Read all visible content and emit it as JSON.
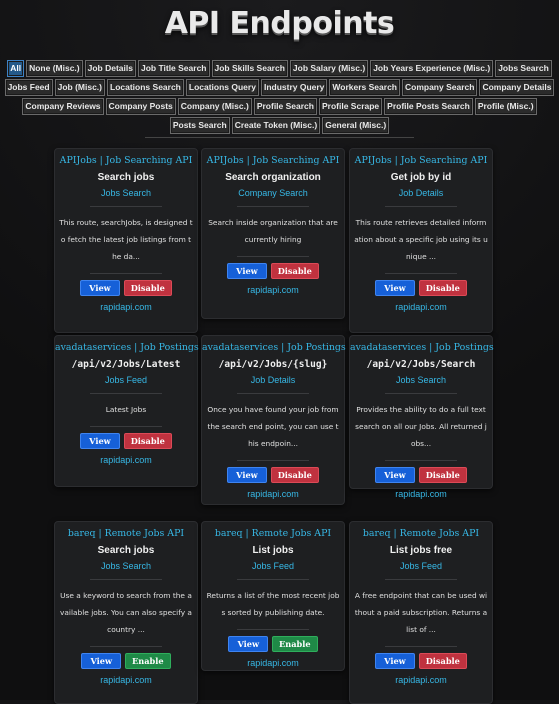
{
  "page": {
    "title": "API Endpoints"
  },
  "tabs": [
    "All",
    "None (Misc.)",
    "Job Details",
    "Job Title Search",
    "Job Skills Search",
    "Job Salary (Misc.)",
    "Job Years Experience (Misc.)",
    "Jobs Search",
    "Jobs Feed",
    "Job (Misc.)",
    "Locations Search",
    "Locations Query",
    "Industry Query",
    "Workers Search",
    "Company Search",
    "Company Details",
    "Company Reviews",
    "Company Posts",
    "Company (Misc.)",
    "Profile Search",
    "Profile Scrape",
    "Profile Posts Search",
    "Profile (Misc.)",
    "Posts Search",
    "Create Token (Misc.)",
    "General (Misc.)"
  ],
  "active_tab": "All",
  "cards": [
    {
      "source": "APIJobs | Job Searching API",
      "name": "Search jobs",
      "category": "Jobs Search",
      "description": "This route, searchJobs, is designed to fetch the latest job listings from the da...",
      "view_label": "View",
      "toggle_label": "Disable",
      "toggle_state": "enabled",
      "footer": "rapidapi.com"
    },
    {
      "source": "APIJobs | Job Searching API",
      "name": "Search organization",
      "category": "Company Search",
      "description": "Search inside organization that are currently hiring",
      "view_label": "View",
      "toggle_label": "Disable",
      "toggle_state": "enabled",
      "footer": "rapidapi.com"
    },
    {
      "source": "APIJobs | Job Searching API",
      "name": "Get job by id",
      "category": "Job Details",
      "description": "This route retrieves detailed information about a specific job using its unique ...",
      "view_label": "View",
      "toggle_label": "Disable",
      "toggle_state": "enabled",
      "footer": "rapidapi.com"
    },
    {
      "source": "avadataservices | Job Postings",
      "name": "/api/v2/Jobs/Latest",
      "category": "Jobs Feed",
      "description": "Latest Jobs",
      "view_label": "View",
      "toggle_label": "Disable",
      "toggle_state": "enabled",
      "footer": "rapidapi.com"
    },
    {
      "source": "avadataservices | Job Postings",
      "name": "/api/v2/Jobs/{slug}",
      "category": "Job Details",
      "description": "Once you have found your job from the search end point, you can use this endpoin...",
      "view_label": "View",
      "toggle_label": "Disable",
      "toggle_state": "enabled",
      "footer": "rapidapi.com"
    },
    {
      "source": "avadataservices | Job Postings",
      "name": "/api/v2/Jobs/Search",
      "category": "Jobs Search",
      "description": "Provides the ability to do a full text search on all our Jobs. All returned jobs...",
      "view_label": "View",
      "toggle_label": "Disable",
      "toggle_state": "enabled",
      "footer": "rapidapi.com"
    },
    {
      "source": "bareq | Remote Jobs API",
      "name": "Search jobs",
      "category": "Jobs Search",
      "description": "Use a keyword to search from the available jobs. You can also specify a country ...",
      "view_label": "View",
      "toggle_label": "Enable",
      "toggle_state": "disabled",
      "footer": "rapidapi.com"
    },
    {
      "source": "bareq | Remote Jobs API",
      "name": "List jobs",
      "category": "Jobs Feed",
      "description": "Returns a list of the most recent jobs sorted by publishing date.",
      "view_label": "View",
      "toggle_label": "Enable",
      "toggle_state": "disabled",
      "footer": "rapidapi.com"
    },
    {
      "source": "bareq | Remote Jobs API",
      "name": "List jobs free",
      "category": "Jobs Feed",
      "description": "A free endpoint that can be used without a paid subscription. Returns a list of ...",
      "view_label": "View",
      "toggle_label": "Disable",
      "toggle_state": "enabled",
      "footer": "rapidapi.com"
    }
  ],
  "colors": {
    "accent": "#37b8e6",
    "view": "#1660d8",
    "disable": "#c0323f",
    "enable": "#1f8a47",
    "active_tab": "#245a8a"
  }
}
